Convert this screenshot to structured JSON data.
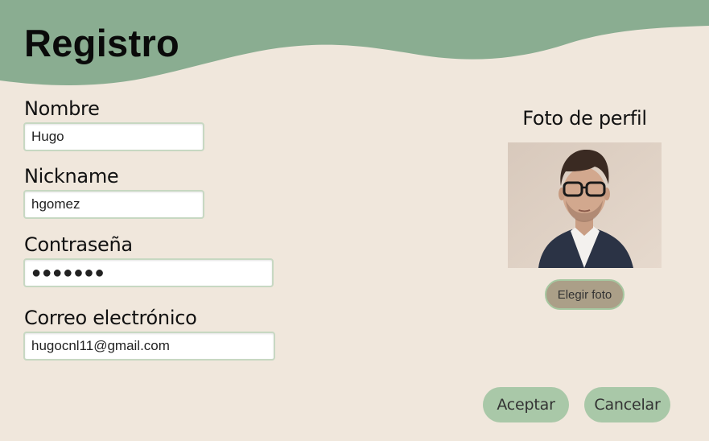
{
  "header": {
    "title": "Registro"
  },
  "form": {
    "name_label": "Nombre",
    "name_value": "Hugo",
    "nickname_label": "Nickname",
    "nickname_value": "hgomez",
    "password_label": "Contraseña",
    "password_value": "●●●●●●●",
    "email_label": "Correo electrónico",
    "email_value": "hugocnl11@gmail.com"
  },
  "profile": {
    "title": "Foto de perfil",
    "choose_photo_label": "Elegir foto"
  },
  "actions": {
    "accept_label": "Aceptar",
    "cancel_label": "Cancelar"
  },
  "colors": {
    "background": "#f0e7dc",
    "header": "#8aad91",
    "button_green": "#a9c8a8",
    "button_tan": "#ab9f88"
  }
}
